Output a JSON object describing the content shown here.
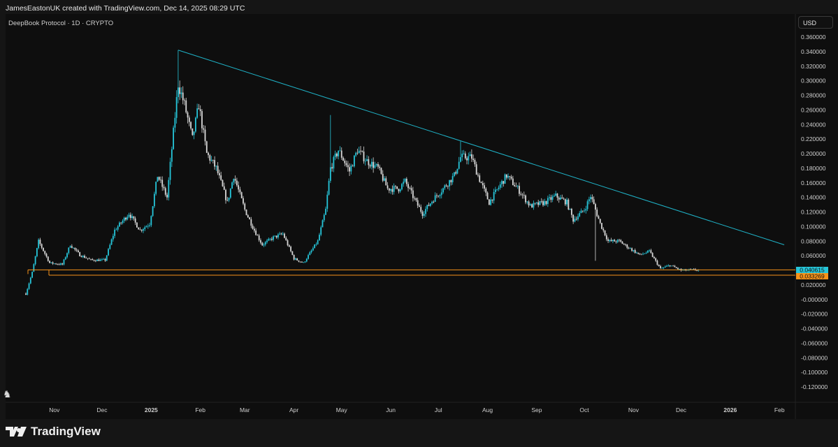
{
  "header": {
    "credit": "JamesEastonUK created with TradingView.com, Dec 14, 2025 08:29 UTC",
    "symbol": "DeepBook Protocol · 1D · CRYPTO",
    "currency": "USD"
  },
  "footer": {
    "brand": "TradingView"
  },
  "colors": {
    "up": "#26c6da",
    "down": "#d9d9d9",
    "trendline": "#1fb3c8",
    "support": "#f7931a",
    "background": "#0e0e0e"
  },
  "chart_data": {
    "type": "candlestick",
    "title": "DeepBook Protocol · 1D · CRYPTO",
    "start_date": "2024-10-14",
    "x_unit": "days since start_date",
    "closes": [
      [
        0,
        0.008
      ],
      [
        4,
        0.037
      ],
      [
        8,
        0.08
      ],
      [
        15,
        0.05
      ],
      [
        23,
        0.048
      ],
      [
        28,
        0.075
      ],
      [
        34,
        0.061
      ],
      [
        41,
        0.054
      ],
      [
        50,
        0.054
      ],
      [
        56,
        0.095
      ],
      [
        65,
        0.118
      ],
      [
        72,
        0.095
      ],
      [
        78,
        0.104
      ],
      [
        83,
        0.17
      ],
      [
        89,
        0.14
      ],
      [
        96,
        0.296
      ],
      [
        100,
        0.267
      ],
      [
        105,
        0.22
      ],
      [
        109,
        0.267
      ],
      [
        114,
        0.2
      ],
      [
        120,
        0.18
      ],
      [
        127,
        0.133
      ],
      [
        131,
        0.17
      ],
      [
        138,
        0.123
      ],
      [
        144,
        0.095
      ],
      [
        149,
        0.075
      ],
      [
        156,
        0.085
      ],
      [
        162,
        0.09
      ],
      [
        169,
        0.056
      ],
      [
        175,
        0.05
      ],
      [
        184,
        0.08
      ],
      [
        189,
        0.123
      ],
      [
        192,
        0.18
      ],
      [
        197,
        0.205
      ],
      [
        204,
        0.176
      ],
      [
        209,
        0.205
      ],
      [
        215,
        0.19
      ],
      [
        222,
        0.18
      ],
      [
        228,
        0.152
      ],
      [
        235,
        0.152
      ],
      [
        239,
        0.162
      ],
      [
        246,
        0.133
      ],
      [
        250,
        0.118
      ],
      [
        257,
        0.138
      ],
      [
        263,
        0.152
      ],
      [
        270,
        0.17
      ],
      [
        274,
        0.195
      ],
      [
        281,
        0.195
      ],
      [
        285,
        0.17
      ],
      [
        292,
        0.133
      ],
      [
        299,
        0.157
      ],
      [
        303,
        0.17
      ],
      [
        310,
        0.152
      ],
      [
        318,
        0.128
      ],
      [
        327,
        0.133
      ],
      [
        334,
        0.142
      ],
      [
        341,
        0.133
      ],
      [
        345,
        0.109
      ],
      [
        352,
        0.123
      ],
      [
        356,
        0.142
      ],
      [
        359,
        0.123
      ],
      [
        362,
        0.104
      ],
      [
        367,
        0.08
      ],
      [
        374,
        0.08
      ],
      [
        380,
        0.071
      ],
      [
        387,
        0.061
      ],
      [
        393,
        0.066
      ],
      [
        400,
        0.042
      ],
      [
        406,
        0.047
      ],
      [
        413,
        0.04
      ],
      [
        424,
        0.0406
      ]
    ],
    "notable_wicks": [
      {
        "day": 96,
        "high": 0.342
      },
      {
        "day": 192,
        "high": 0.253
      },
      {
        "day": 274,
        "high": 0.217
      },
      {
        "day": 359,
        "low": 0.053
      }
    ],
    "trendline": {
      "from": [
        96,
        0.342
      ],
      "to": [
        478,
        0.075
      ]
    },
    "horizontal_levels": [
      {
        "value": 0.040615,
        "label": "0.040615",
        "color": "#26c6da"
      },
      {
        "value": 0.033269,
        "label": "0.033269",
        "color": "#f7931a"
      }
    ],
    "y_ticks": [
      "0.360000",
      "0.340000",
      "0.320000",
      "0.300000",
      "0.280000",
      "0.260000",
      "0.240000",
      "0.220000",
      "0.200000",
      "0.180000",
      "0.160000",
      "0.140000",
      "0.120000",
      "0.100000",
      "0.080000",
      "0.060000",
      "0.040000",
      "0.020000",
      "-0.000000",
      "-0.020000",
      "-0.040000",
      "-0.060000",
      "-0.080000",
      "-0.100000",
      "-0.120000"
    ],
    "x_ticks": [
      {
        "label": "Nov",
        "day": 18
      },
      {
        "label": "Dec",
        "day": 48
      },
      {
        "label": "2025",
        "day": 79
      },
      {
        "label": "Feb",
        "day": 110
      },
      {
        "label": "Mar",
        "day": 138
      },
      {
        "label": "Apr",
        "day": 169
      },
      {
        "label": "May",
        "day": 199
      },
      {
        "label": "Jun",
        "day": 230
      },
      {
        "label": "Jul",
        "day": 260
      },
      {
        "label": "Aug",
        "day": 291
      },
      {
        "label": "Sep",
        "day": 322
      },
      {
        "label": "Oct",
        "day": 352
      },
      {
        "label": "Nov",
        "day": 383
      },
      {
        "label": "Dec",
        "day": 413
      },
      {
        "label": "2026",
        "day": 444
      },
      {
        "label": "Feb",
        "day": 475
      }
    ],
    "ylim": [
      -0.13,
      0.37
    ]
  }
}
